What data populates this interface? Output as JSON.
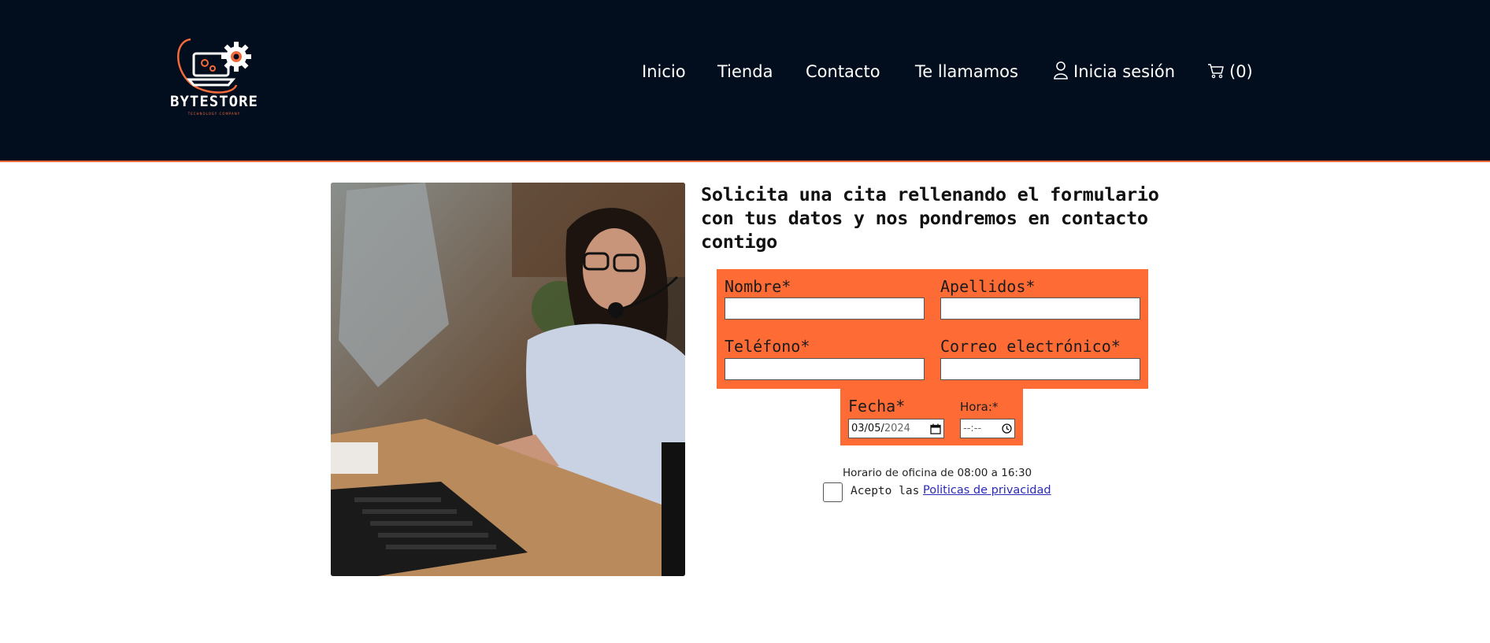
{
  "brand": {
    "name": "BYTESTORE",
    "tagline": "TECHNOLOGY COMPANY",
    "colors": {
      "header_bg": "#020d1e",
      "accent": "#ff6b35",
      "link": "#2a2ab8"
    }
  },
  "nav": {
    "items": [
      {
        "label": "Inicio"
      },
      {
        "label": "Tienda"
      },
      {
        "label": "Contacto"
      },
      {
        "label": "Te llamamos"
      }
    ],
    "login": {
      "label": "Inicia sesión",
      "icon": "user-icon"
    },
    "cart": {
      "label": "(0)",
      "icon": "cart-icon"
    }
  },
  "main": {
    "headline": "Solicita una cita rellenando el formulario con tus datos y nos pondremos en contacto contigo",
    "form": {
      "nombre_label": "Nombre*",
      "nombre_value": "",
      "apellidos_label": "Apellidos*",
      "apellidos_value": "",
      "telefono_label": "Teléfono*",
      "telefono_value": "",
      "correo_label": "Correo electrónico*",
      "correo_value": "",
      "fecha_label": "Fecha*",
      "fecha_value_day_month": "03/05/",
      "fecha_value_year": "2024",
      "hora_label": "Hora:*",
      "hora_value": "--:--",
      "office_hours": "Horario de oficina de 08:00 a 16:30",
      "accept_text": "Acepto las",
      "privacy_link": "Politicas de privacidad"
    }
  }
}
